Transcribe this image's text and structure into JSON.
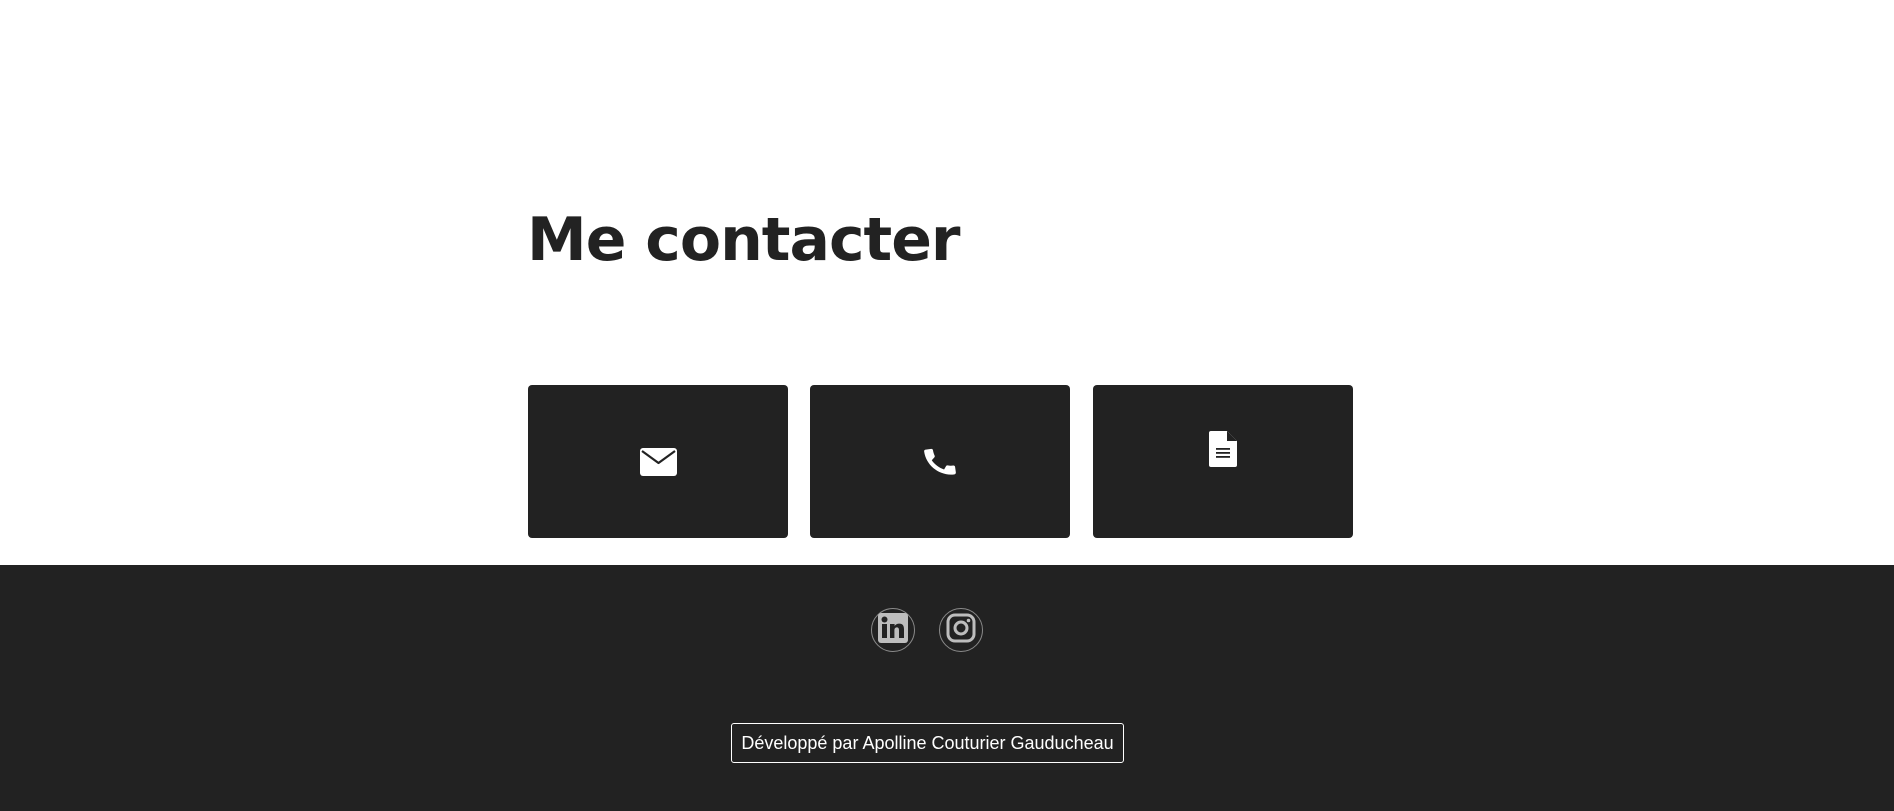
{
  "contact": {
    "title": "Me contacter",
    "cards": [
      {
        "icon": "envelope-icon",
        "action": "email"
      },
      {
        "icon": "phone-icon",
        "action": "phone"
      },
      {
        "icon": "document-icon",
        "action": "cv"
      }
    ]
  },
  "footer": {
    "socials": [
      {
        "icon": "linkedin-icon"
      },
      {
        "icon": "instagram-icon"
      }
    ],
    "credit": "Développé par Apolline Couturier Gauducheau"
  },
  "colors": {
    "dark": "#222222",
    "text_light": "#ffffff",
    "icon_muted": "#bdbdbd"
  }
}
